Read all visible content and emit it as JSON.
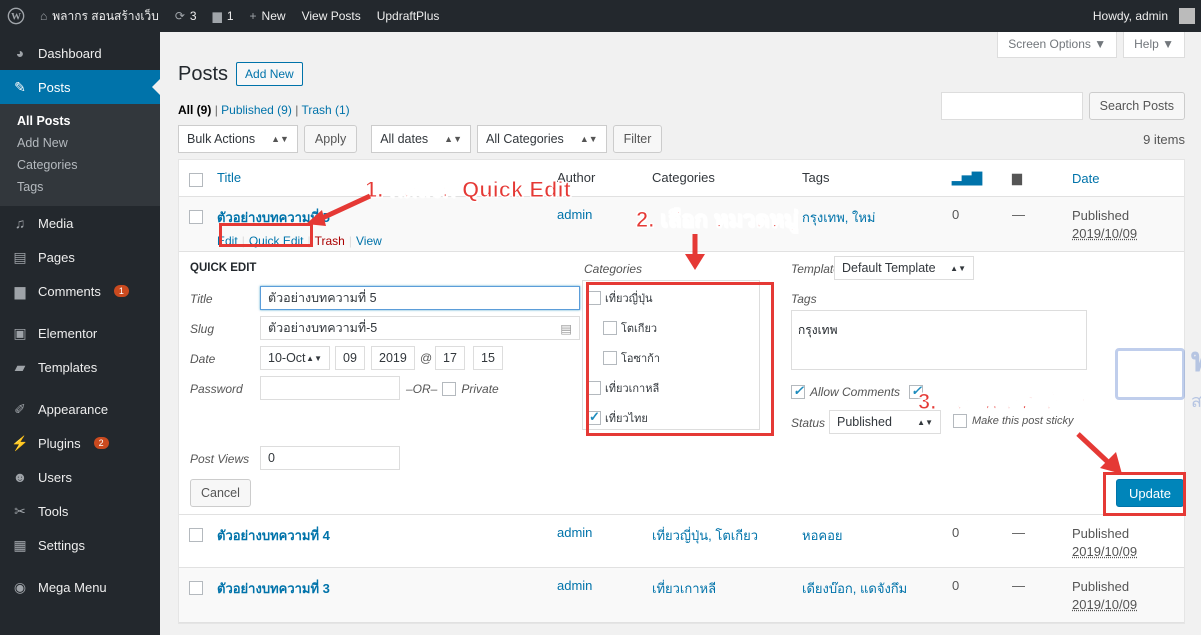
{
  "adminbar": {
    "site_name": "พลากร สอนสร้างเว็บ",
    "updates_count": "3",
    "comments_count": "1",
    "new_label": "New",
    "view_posts": "View Posts",
    "updraft": "UpdraftPlus",
    "howdy": "Howdy, admin"
  },
  "sidebar": {
    "items": [
      {
        "label": "Dashboard",
        "icon": "dashboard-icon"
      },
      {
        "label": "Posts",
        "icon": "pin-icon"
      },
      {
        "label": "Media",
        "icon": "media-icon"
      },
      {
        "label": "Pages",
        "icon": "pages-icon"
      },
      {
        "label": "Comments",
        "icon": "comments-icon",
        "badge": "1"
      },
      {
        "label": "Elementor",
        "icon": "elementor-icon"
      },
      {
        "label": "Templates",
        "icon": "folder-icon"
      },
      {
        "label": "Appearance",
        "icon": "brush-icon"
      },
      {
        "label": "Plugins",
        "icon": "plugin-icon",
        "badge": "2"
      },
      {
        "label": "Users",
        "icon": "users-icon"
      },
      {
        "label": "Tools",
        "icon": "wrench-icon"
      },
      {
        "label": "Settings",
        "icon": "settings-icon"
      },
      {
        "label": "Mega Menu",
        "icon": "menu-icon"
      }
    ],
    "submenu": [
      "All Posts",
      "Add New",
      "Categories",
      "Tags"
    ]
  },
  "screen_options": "Screen Options ▼",
  "help": "Help ▼",
  "page": {
    "title": "Posts",
    "add_new": "Add New",
    "filter_all": "All (9)",
    "filter_published": "Published (9)",
    "filter_trash": "Trash (1)",
    "search_button": "Search Posts",
    "items_count": "9 items"
  },
  "tablenav": {
    "bulk": "Bulk Actions",
    "apply": "Apply",
    "dates": "All dates",
    "categories": "All Categories",
    "filter": "Filter"
  },
  "table": {
    "columns": {
      "title": "Title",
      "author": "Author",
      "categories": "Categories",
      "tags": "Tags",
      "date": "Date"
    },
    "rows": [
      {
        "title": "ตัวอย่างบทความที่ 5",
        "author": "admin",
        "categories": "",
        "tags": "กรุงเทพ, ใหม่",
        "views": "0",
        "comments": "—",
        "status": "Published",
        "date": "2019/10/09",
        "actions": [
          "Edit",
          "Quick Edit",
          "Trash",
          "View"
        ]
      },
      {
        "title": "ตัวอย่างบทความที่ 4",
        "author": "admin",
        "categories": "เที่ยวญี่ปุ่น, โตเกียว",
        "tags": "หอคอย",
        "views": "0",
        "comments": "—",
        "status": "Published",
        "date": "2019/10/09"
      },
      {
        "title": "ตัวอย่างบทความที่ 3",
        "author": "admin",
        "categories": "เที่ยวเกาหลี",
        "tags": "เดียงบ๊อก, แดจังกึม",
        "views": "0",
        "comments": "—",
        "status": "Published",
        "date": "2019/10/09"
      }
    ]
  },
  "quick_edit": {
    "legend": "QUICK EDIT",
    "title_label": "Title",
    "title_value": "ตัวอย่างบทความที่ 5",
    "slug_label": "Slug",
    "slug_value": "ตัวอย่างบทความที่-5",
    "date_label": "Date",
    "month": "10-Oct",
    "day": "09",
    "year": "2019",
    "at": "@",
    "hour": "17",
    "minute": "15",
    "password_label": "Password",
    "or": "–OR–",
    "private": "Private",
    "categories_label": "Categories",
    "categories": [
      {
        "name": "เที่ยวญี่ปุ่น",
        "checked": false
      },
      {
        "name": "โตเกียว",
        "checked": false
      },
      {
        "name": "โอซาก้า",
        "checked": false
      },
      {
        "name": "เที่ยวเกาหลี",
        "checked": false
      },
      {
        "name": "เที่ยวไทย",
        "checked": true
      }
    ],
    "template_label": "Template",
    "template_value": "Default Template",
    "tags_label": "Tags",
    "tags_value": "กรุงเทพ",
    "allow_comments": "Allow Comments",
    "status_label": "Status",
    "status_value": "Published",
    "sticky": "Make this post sticky",
    "post_views_label": "Post Views",
    "post_views_value": "0",
    "cancel": "Cancel",
    "update": "Update"
  },
  "annotations": {
    "step1": "1. กดลิงค์ Quick Edit",
    "step2": "2. เลือก หมวดหมู่",
    "step3": "3. กดอัพเดทได้เลย"
  },
  "watermark": {
    "big": "พลากร",
    "small": "สอนสร้างเว็บ"
  },
  "colors": {
    "accent": "#0073aa",
    "admin_bar": "#23282d",
    "annotation": "#e53935",
    "badge": "#ca4a1f"
  }
}
